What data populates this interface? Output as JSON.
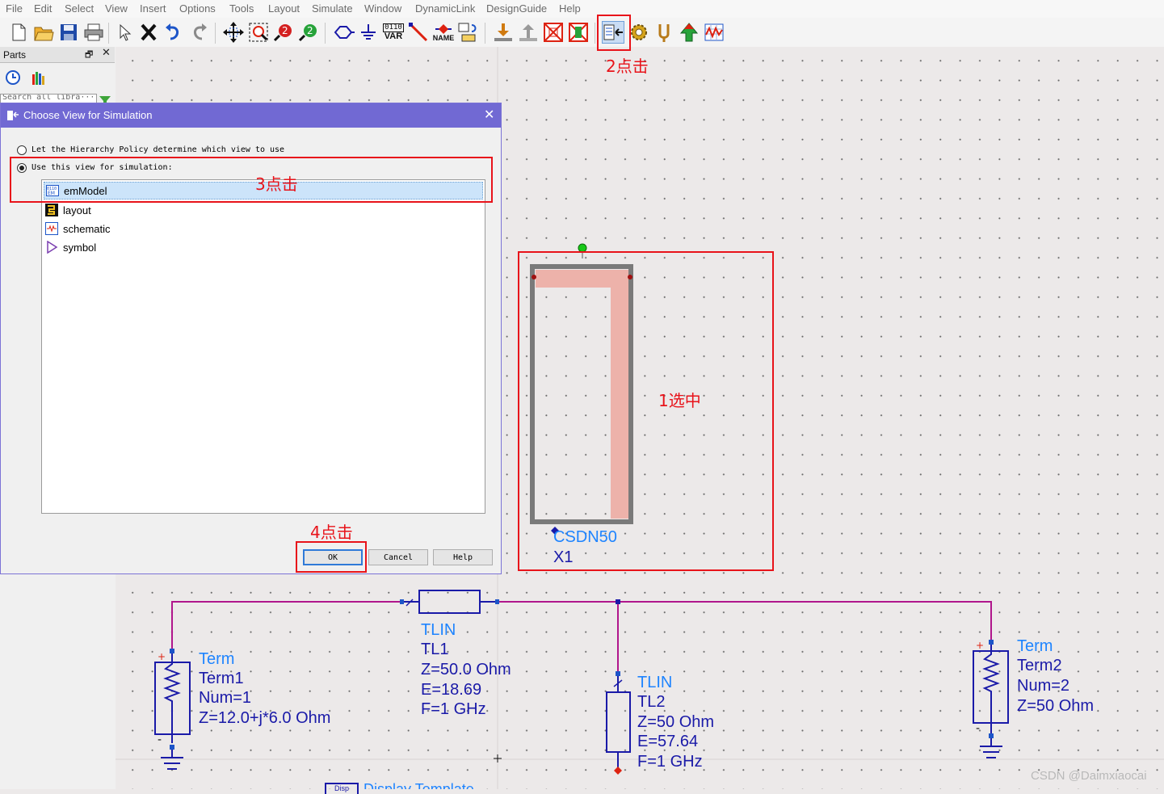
{
  "menu": [
    "File",
    "Edit",
    "Select",
    "View",
    "Insert",
    "Options",
    "Tools",
    "Layout",
    "Simulate",
    "Window",
    "DynamicLink",
    "DesignGuide",
    "Help"
  ],
  "toolbar": {
    "var_label": "VAR",
    "var_bits": "0110",
    "name_label": "NAME"
  },
  "parts_panel": {
    "title": "Parts",
    "search_placeholder": "Search all libra···"
  },
  "dialog": {
    "title": "Choose View for Simulation",
    "option1": "Let the Hierarchy Policy determine which view to use",
    "option2": "Use this view for simulation:",
    "selected_option": 2,
    "views": [
      {
        "label": "emModel",
        "icon": "em-model-icon",
        "selected": true
      },
      {
        "label": "layout",
        "icon": "layout-icon",
        "selected": false
      },
      {
        "label": "schematic",
        "icon": "schematic-icon",
        "selected": false
      },
      {
        "label": "symbol",
        "icon": "symbol-icon",
        "selected": false
      }
    ],
    "ok": "OK",
    "cancel": "Cancel",
    "help": "Help"
  },
  "annotations": {
    "step1": "1选中",
    "step2": "2点击",
    "step3": "3点击",
    "step4": "4点击"
  },
  "component": {
    "name": "CSDN50",
    "instance": "X1"
  },
  "tl1": {
    "type": "TLIN",
    "name": "TL1",
    "z": "Z=50.0 Ohm",
    "e": "E=18.69",
    "f": "F=1 GHz"
  },
  "tl2": {
    "type": "TLIN",
    "name": "TL2",
    "z": "Z=50 Ohm",
    "e": "E=57.64",
    "f": "F=1 GHz"
  },
  "term1": {
    "type": "Term",
    "name": "Term1",
    "num": "Num=1",
    "z": "Z=12.0+j*6.0 Ohm"
  },
  "term2": {
    "type": "Term",
    "name": "Term2",
    "num": "Num=2",
    "z": "Z=50 Ohm"
  },
  "bottom_partial": {
    "box": "Disp",
    "text": "Display Template"
  },
  "watermark": "CSDN @Daimxiaocai",
  "colors": {
    "annotation_red": "#e8131a",
    "wire": "#b0168c",
    "blue_text": "#1e84ff",
    "navy_text": "#1a1aa8",
    "dialog_title": "#7169d3"
  }
}
